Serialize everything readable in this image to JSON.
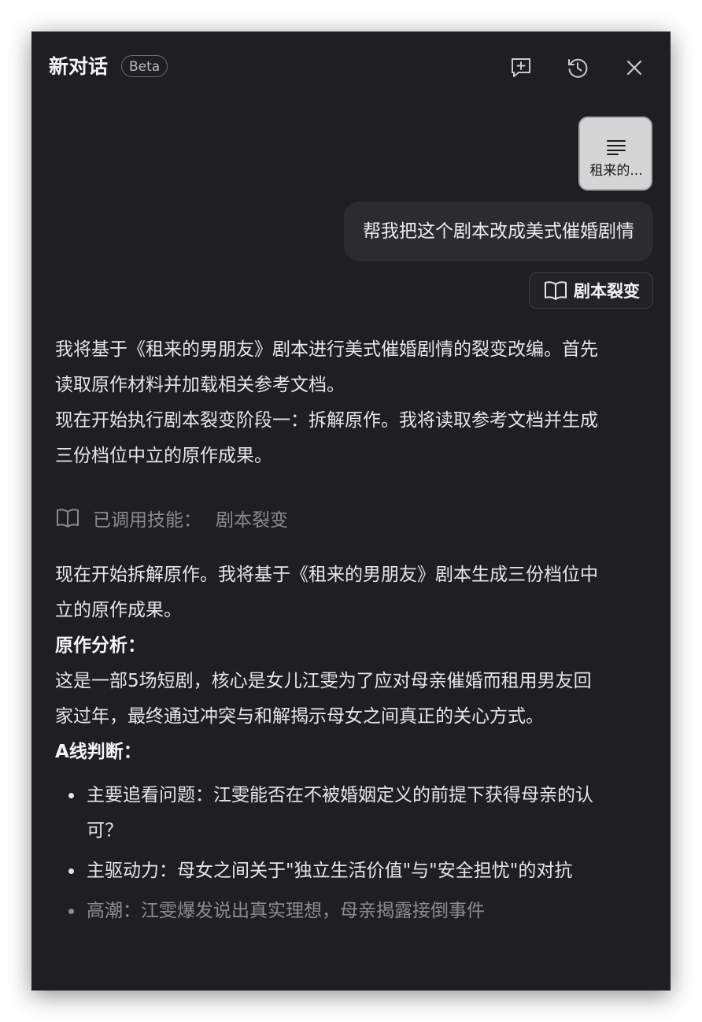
{
  "header": {
    "title": "新对话",
    "badge": "Beta",
    "icons": [
      "new-chat-icon",
      "history-icon",
      "close-icon"
    ]
  },
  "attachment": {
    "name": "租来的...",
    "icon": "document-lines-icon"
  },
  "user_message": "帮我把这个剧本改成美式催婚剧情",
  "skill_chip": {
    "label": "剧本裂变",
    "icon": "book-icon"
  },
  "assistant": {
    "intro_1": "我将基于《租来的男朋友》剧本进行美式催婚剧情的裂变改编。首先读取原作材料并加载相关参考文档。",
    "intro_2": "现在开始执行剧本裂变阶段一：拆解原作。我将读取参考文档并生成三份档位中立的原作成果。",
    "invoked_label": "已调用技能：",
    "invoked_skill": "剧本裂变",
    "body_1": "现在开始拆解原作。我将基于《租来的男朋友》剧本生成三份档位中立的原作成果。",
    "heading_analysis": "原作分析：",
    "analysis": "这是一部5场短剧，核心是女儿江雯为了应对母亲催婚而租用男友回家过年，最终通过冲突与和解揭示母女之间真正的关心方式。",
    "heading_a_line": "A线判断：",
    "bullets": [
      "主要追看问题：江雯能否在不被婚姻定义的前提下获得母亲的认可？",
      "主驱动力：母女之间关于\"独立生活价值\"与\"安全担忧\"的对抗",
      "高潮：江雯爆发说出真实理想，母亲揭露接倒事件"
    ]
  },
  "colors": {
    "panel_bg": "#1f1f21",
    "bubble_bg": "#2c2c30",
    "text": "#e6e6e8",
    "muted": "#8a8a90"
  }
}
